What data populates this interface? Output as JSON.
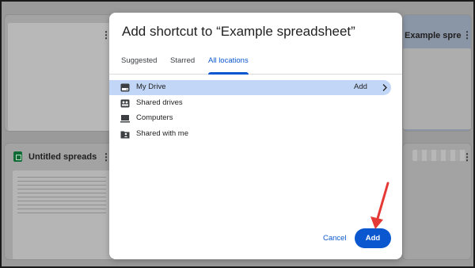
{
  "background": {
    "top_right_card_title": "Example spreadsh…",
    "bottom_left_card_title": "Untitled spreadshe…"
  },
  "dialog": {
    "title": "Add shortcut to “Example spreadsheet”",
    "tabs": [
      {
        "label": "Suggested",
        "active": false
      },
      {
        "label": "Starred",
        "active": false
      },
      {
        "label": "All locations",
        "active": true
      }
    ],
    "locations": [
      {
        "label": "My Drive",
        "icon": "drive-icon",
        "selected": true,
        "action_label": "Add"
      },
      {
        "label": "Shared drives",
        "icon": "shared-drives-icon",
        "selected": false
      },
      {
        "label": "Computers",
        "icon": "computer-icon",
        "selected": false
      },
      {
        "label": "Shared with me",
        "icon": "shared-with-me-icon",
        "selected": false
      }
    ],
    "cancel_label": "Cancel",
    "add_label": "Add"
  },
  "colors": {
    "accent": "#0b57d0",
    "selected_row": "#c2d7f7",
    "annotation_arrow": "#e53935"
  }
}
